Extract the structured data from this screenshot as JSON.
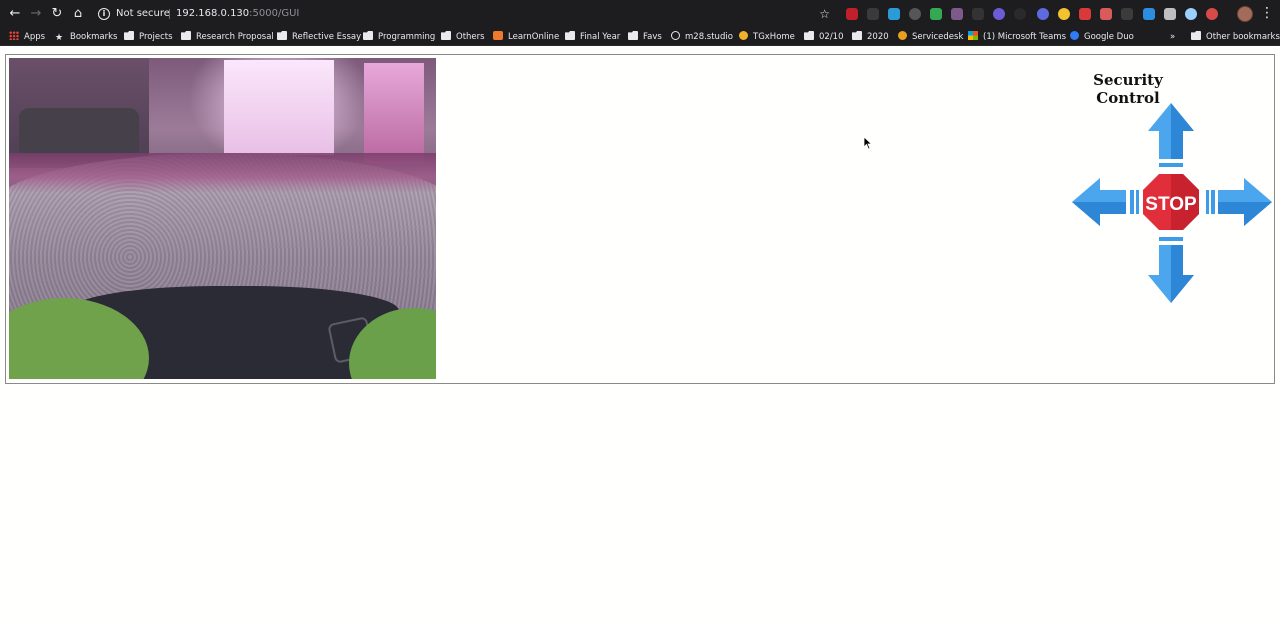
{
  "browser": {
    "security_label": "Not secure",
    "url_host": "192.168.0.130",
    "url_path": ":5000/GUI",
    "bookmarks": [
      {
        "label": "Apps",
        "icon": "apps-grid-icon"
      },
      {
        "label": "Bookmarks",
        "icon": "star-icon"
      },
      {
        "label": "Projects",
        "icon": "folder-icon"
      },
      {
        "label": "Research Proposal",
        "icon": "folder-icon"
      },
      {
        "label": "Reflective Essay",
        "icon": "folder-icon"
      },
      {
        "label": "Programming",
        "icon": "folder-icon"
      },
      {
        "label": "Others",
        "icon": "folder-icon"
      },
      {
        "label": "LearnOnline",
        "icon": "site-icon"
      },
      {
        "label": "Final Year",
        "icon": "folder-icon"
      },
      {
        "label": "Favs",
        "icon": "folder-icon"
      },
      {
        "label": "m28.studio",
        "icon": "globe-icon"
      },
      {
        "label": "TGxHome",
        "icon": "site-icon"
      },
      {
        "label": "02/10",
        "icon": "folder-icon"
      },
      {
        "label": "2020",
        "icon": "folder-icon"
      },
      {
        "label": "Servicedesk",
        "icon": "site-icon"
      },
      {
        "label": "(1) Microsoft Teams",
        "icon": "microsoft-icon"
      },
      {
        "label": "Google Duo",
        "icon": "site-icon"
      }
    ],
    "overflow_label": "»",
    "other_bookmarks": "Other bookmarks"
  },
  "page": {
    "title": "Security Control",
    "camera_feed": {
      "description_icon": "camera-feed-image"
    },
    "controls": {
      "stop_label": "STOP",
      "colors": {
        "arrow": "#3d9be9",
        "arrow_dark": "#1f74c2",
        "stop": "#e02f3a",
        "stop_dark": "#b81d2a"
      }
    }
  }
}
